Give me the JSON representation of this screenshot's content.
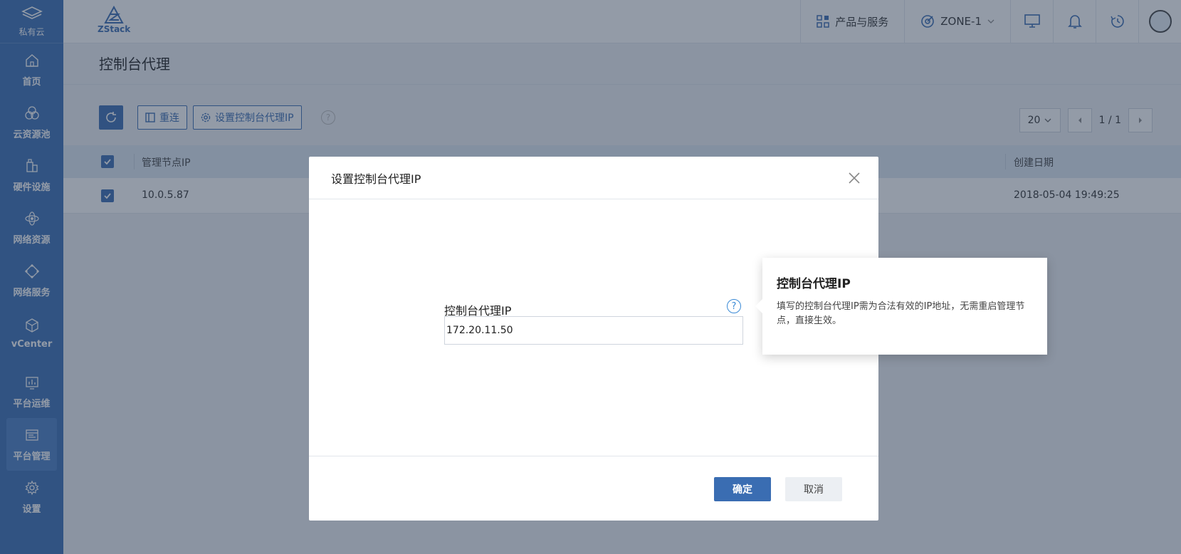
{
  "sidebar": {
    "brand_label": "私有云",
    "items": [
      {
        "label": "首页",
        "icon": "home-icon"
      },
      {
        "label": "云资源池",
        "icon": "resource-pool-icon"
      },
      {
        "label": "硬件设施",
        "icon": "hardware-icon"
      },
      {
        "label": "网络资源",
        "icon": "network-resource-icon"
      },
      {
        "label": "网络服务",
        "icon": "network-service-icon"
      },
      {
        "label": "vCenter",
        "icon": "vcenter-icon"
      },
      {
        "label": "平台运维",
        "icon": "ops-icon"
      },
      {
        "label": "平台管理",
        "icon": "platform-manage-icon",
        "active": true
      },
      {
        "label": "设置",
        "icon": "gear-icon"
      }
    ]
  },
  "topbar": {
    "logo_text": "ZStack",
    "products_label": "产品与服务",
    "zone_label": "ZONE-1"
  },
  "page": {
    "title": "控制台代理"
  },
  "toolbar": {
    "reconnect_label": "重连",
    "set_proxy_label": "设置控制台代理IP",
    "help_glyph": "?",
    "page_size": "20",
    "page_indicator": "1 / 1"
  },
  "table": {
    "headers": {
      "mgmt_ip": "管理节点IP",
      "created": "创建日期"
    },
    "rows": [
      {
        "mgmt_ip": "10.0.5.87",
        "created": "2018-05-04 19:49:25"
      }
    ]
  },
  "modal": {
    "title": "设置控制台代理IP",
    "field_label": "控制台代理IP",
    "field_value": "172.20.11.50",
    "help_glyph": "?",
    "ok_label": "确定",
    "cancel_label": "取消"
  },
  "tooltip": {
    "title": "控制台代理IP",
    "body": "填写的控制台代理IP需为合法有效的IP地址，无需重启管理节点，直接生效。"
  },
  "colors": {
    "primary": "#3a6db2",
    "sidebar_bg": "#3b6fb5",
    "help_blue": "#3a8ad6"
  }
}
